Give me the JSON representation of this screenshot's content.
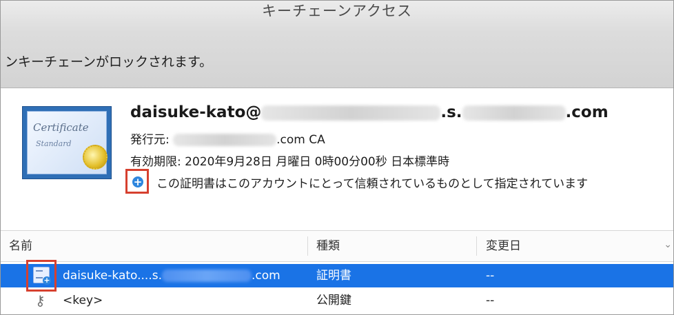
{
  "window": {
    "title": "キーチェーンアクセス"
  },
  "toolbar": {
    "lock_notice": "ンキーチェーンがロックされます。"
  },
  "certificate": {
    "icon_text_1": "Certificate",
    "icon_text_2": "Standard",
    "name_prefix": "daisuke-kato@",
    "name_mid": ".s.",
    "name_suffix": ".com",
    "issuer_label": "発行元:",
    "issuer_suffix": ".com CA",
    "expiry_label": "有効期限:",
    "expiry_value": "2020年9月28日 月曜日 0時00分00秒 日本標準時",
    "trust_text": "この証明書はこのアカウントにとって信頼されているものとして指定されています"
  },
  "table": {
    "columns": [
      "名前",
      "種類",
      "変更日"
    ],
    "rows": [
      {
        "name_prefix": "daisuke-kato....s.",
        "name_suffix": ".com",
        "kind": "証明書",
        "date": "--",
        "selected": true,
        "icon": "certificate-plus-icon"
      },
      {
        "name": "<key>",
        "kind": "公開鍵",
        "date": "--",
        "selected": false,
        "icon": "key-icon"
      }
    ]
  },
  "colors": {
    "selection": "#1a73e6",
    "highlight_box": "#d6402f",
    "trust_icon": "#2e86de"
  }
}
